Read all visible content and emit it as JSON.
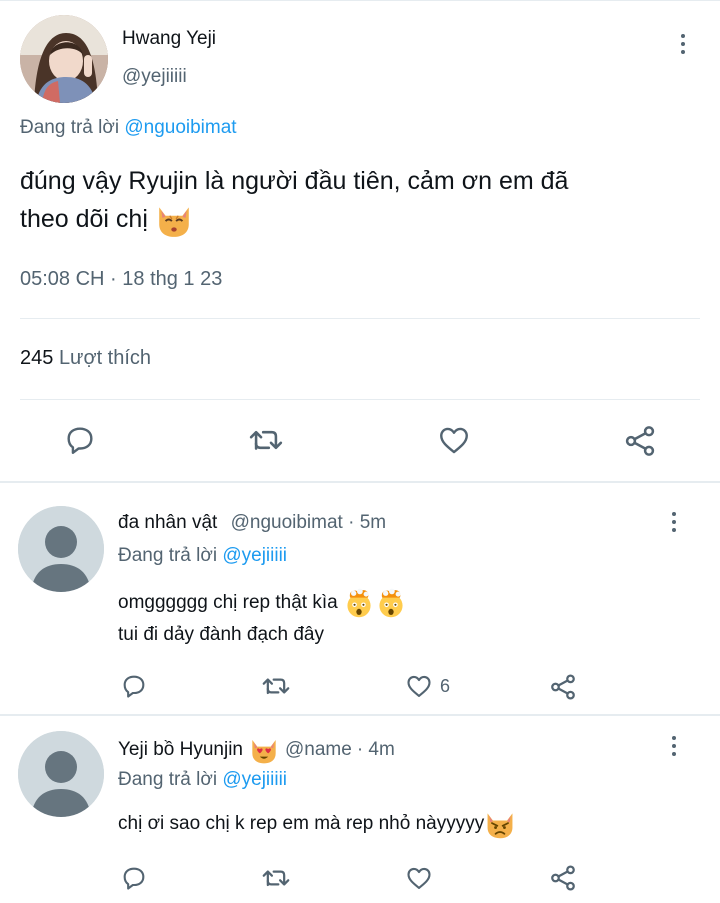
{
  "main_tweet": {
    "author_name": "Hwang Yeji",
    "author_handle": "@yejiiiii",
    "reply_prefix": "Đang trả lời",
    "reply_to": "@nguoibimat",
    "text_line1": "đúng vậy Ryujin là người đầu tiên,  cảm ơn em đã",
    "text_line2": "theo dõi chị",
    "text_emoji": "kissing-cat-emoji",
    "timestamp": "05:08 CH · 18 thg 1 23",
    "like_count": "245",
    "like_label": "Lượt thích"
  },
  "replies": [
    {
      "author_name": "đa nhân vật",
      "author_handle": "@nguoibimat",
      "time": "· 5m",
      "reply_prefix": "Đang trả lời",
      "reply_to": "@yejiiiii",
      "line1": "omgggggg chị rep thật kìa",
      "line1_emojis": [
        "exploding-head-emoji",
        "exploding-head-emoji"
      ],
      "line2": "tui đi dảy đành đạch đây",
      "like_count": "6"
    },
    {
      "author_name": "Yeji bồ Hyunjin",
      "name_emoji": "heart-eyes-cat-emoji",
      "author_handle": "@name",
      "time": "· 4m",
      "reply_prefix": "Đang trả lời",
      "reply_to": "@yejiiiii",
      "line1": "chị ơi sao chị k rep em mà rep nhỏ nàyyyyy",
      "line1_emoji": "pouting-cat-emoji"
    }
  ],
  "colors": {
    "link": "#1d9bf0",
    "muted": "#536471",
    "text": "#0f1419",
    "divider": "#e6ecf0"
  }
}
